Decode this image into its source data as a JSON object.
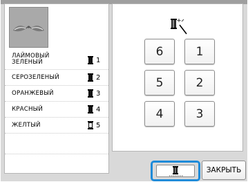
{
  "colors": [
    {
      "name": "ЛАЙМОВЫЙ ЗЕЛЕНЫЙ",
      "number": "1",
      "filled": true
    },
    {
      "name": "СЕРОЗЕЛЕНЫЙ",
      "number": "2",
      "filled": true
    },
    {
      "name": "ОРАНЖЕВЫЙ",
      "number": "3",
      "filled": true
    },
    {
      "name": "КРАСНЫЙ",
      "number": "4",
      "filled": true
    },
    {
      "name": "ЖЕЛТЫЙ",
      "number": "5",
      "filled": false
    }
  ],
  "keys": {
    "k6": "6",
    "k1": "1",
    "k5": "5",
    "k2": "2",
    "k4": "4",
    "k3": "3"
  },
  "buttons": {
    "close_label": "ЗАКРЫТЬ",
    "thread_icon": "thread-spool-icon"
  },
  "icons": {
    "wand": "spool-magic-wand-icon",
    "preview": "embroidery-pattern-preview"
  },
  "accent_color": "#1f8bd9"
}
